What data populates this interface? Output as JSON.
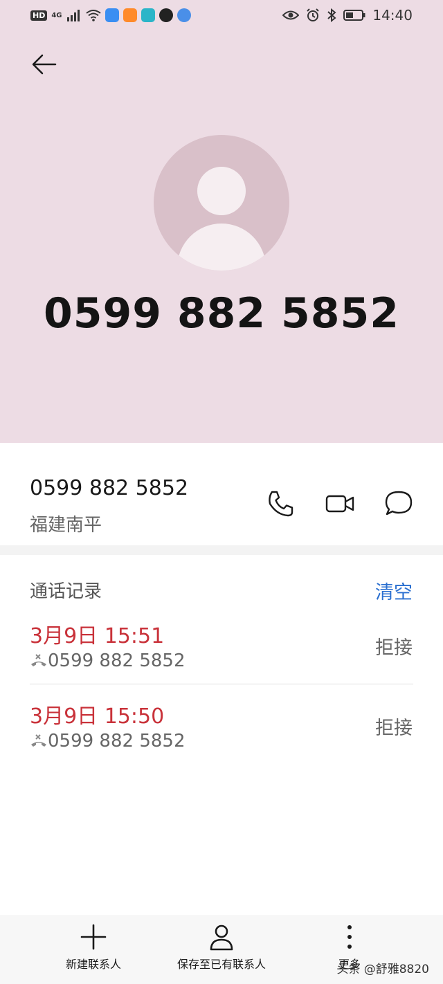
{
  "status_bar": {
    "left_badges": [
      "HD",
      "4G"
    ],
    "time": "14:40",
    "icons": [
      "signal-icon",
      "wifi-icon",
      "cloud-app-icon",
      "video-app-icon",
      "reader-app-icon",
      "qq-app-icon",
      "browser-app-icon",
      "eye-icon",
      "alarm-icon",
      "bluetooth-icon",
      "battery-icon"
    ]
  },
  "header": {
    "number": "0599 882 5852"
  },
  "contact": {
    "number": "0599 882 5852",
    "location": "福建南平"
  },
  "records": {
    "title": "通话记录",
    "clear_label": "清空",
    "items": [
      {
        "date": "3月9日 15:51",
        "number": "0599 882 5852",
        "status": "拒接"
      },
      {
        "date": "3月9日 15:50",
        "number": "0599 882 5852",
        "status": "拒接"
      }
    ]
  },
  "bottom_bar": {
    "new_contact": "新建联系人",
    "save_existing": "保存至已有联系人",
    "more": "更多"
  },
  "watermark": "头条 @舒雅8820",
  "colors": {
    "header_bg": "#eddce4",
    "accent_blue": "#2a6fd0",
    "missed_red": "#c9323a"
  }
}
